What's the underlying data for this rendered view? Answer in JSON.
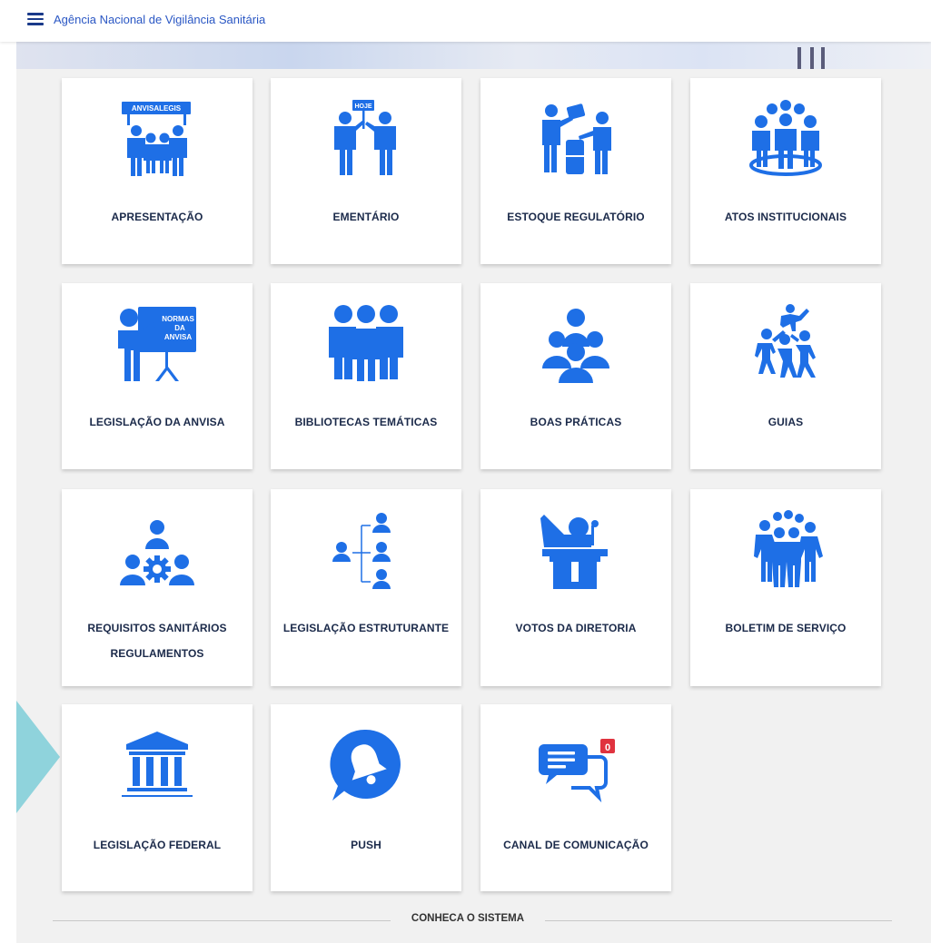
{
  "header": {
    "title": "Agência Nacional de Vigilância Sanitária",
    "menu_icon": "hamburger-menu-icon"
  },
  "colors": {
    "icon_blue": "#1e6fe6",
    "title_blue": "#2a57c4",
    "card_text": "#1b2a4a",
    "background": "#f1f1f1",
    "badge_red": "#e0333f",
    "accent_teal": "#8fd3dc"
  },
  "cards": [
    {
      "label": "APRESENTAÇÃO",
      "icon": "protest-people-icon",
      "sign": "ANVISALEGIS"
    },
    {
      "label": "EMENTÁRIO",
      "icon": "presenters-icon",
      "sign": "HOJE"
    },
    {
      "label": "ESTOQUE REGULATÓRIO",
      "icon": "document-handover-icon"
    },
    {
      "label": "ATOS INSTITUCIONAIS",
      "icon": "group-circle-icon"
    },
    {
      "label": "LEGISLAÇÃO DA ANVISA",
      "icon": "presentation-board-icon",
      "board_line1": "NORMAS",
      "board_line2": "DA",
      "board_line3": "ANVISA"
    },
    {
      "label": "BIBLIOTECAS TEMÁTICAS",
      "icon": "three-people-icon"
    },
    {
      "label": "BOAS PRÁTICAS",
      "icon": "people-group-icon"
    },
    {
      "label": "GUIAS",
      "icon": "human-pyramid-icon"
    },
    {
      "label_line1": "REQUISITOS SANITÁRIOS",
      "label_line2": "REGULAMENTOS",
      "icon": "people-gear-icon"
    },
    {
      "label": "LEGISLAÇÃO ESTRUTURANTE",
      "icon": "org-chart-icon"
    },
    {
      "label": "VOTOS DA DIRETORIA",
      "icon": "speaker-podium-icon"
    },
    {
      "label": "BOLETIM DE SERVIÇO",
      "icon": "crowd-icon"
    },
    {
      "label": "LEGISLAÇÃO FEDERAL",
      "icon": "government-building-icon"
    },
    {
      "label": "PUSH",
      "icon": "bell-bubble-icon"
    },
    {
      "label": "CANAL DE COMUNICAÇÃO",
      "icon": "chat-bubbles-icon",
      "badge": "0"
    }
  ],
  "footer": {
    "section_title": "CONHECA O SISTEMA"
  }
}
